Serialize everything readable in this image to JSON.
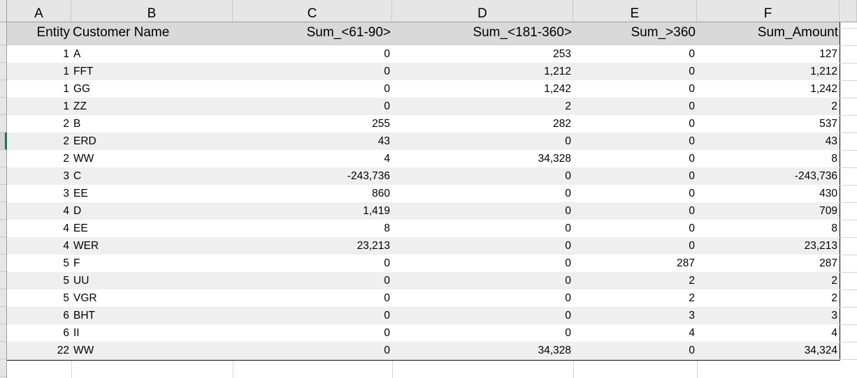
{
  "columns": [
    "A",
    "B",
    "C",
    "D",
    "E",
    "F"
  ],
  "headers": [
    "Entity",
    "Customer Name",
    "Sum_<61-90>",
    "Sum_<181-360>",
    "Sum_>360",
    "Sum_Amount"
  ],
  "selected_row_index": 5,
  "accent_color": "#217346",
  "rows": [
    [
      "1",
      "A",
      "0",
      "253",
      "0",
      "127"
    ],
    [
      "1",
      "FFT",
      "0",
      "1,212",
      "0",
      "1,212"
    ],
    [
      "1",
      "GG",
      "0",
      "1,242",
      "0",
      "1,242"
    ],
    [
      "1",
      "ZZ",
      "0",
      "2",
      "0",
      "2"
    ],
    [
      "2",
      "B",
      "255",
      "282",
      "0",
      "537"
    ],
    [
      "2",
      "ERD",
      "43",
      "0",
      "0",
      "43"
    ],
    [
      "2",
      "WW",
      "4",
      "34,328",
      "0",
      "8"
    ],
    [
      "3",
      "C",
      "-243,736",
      "0",
      "0",
      "-243,736"
    ],
    [
      "3",
      "EE",
      "860",
      "0",
      "0",
      "430"
    ],
    [
      "4",
      "D",
      "1,419",
      "0",
      "0",
      "709"
    ],
    [
      "4",
      "EE",
      "8",
      "0",
      "0",
      "8"
    ],
    [
      "4",
      "WER",
      "23,213",
      "0",
      "0",
      "23,213"
    ],
    [
      "5",
      "F",
      "0",
      "0",
      "287",
      "287"
    ],
    [
      "5",
      "UU",
      "0",
      "0",
      "2",
      "2"
    ],
    [
      "5",
      "VGR",
      "0",
      "0",
      "2",
      "2"
    ],
    [
      "6",
      "BHT",
      "0",
      "0",
      "3",
      "3"
    ],
    [
      "6",
      "II",
      "0",
      "0",
      "4",
      "4"
    ],
    [
      "22",
      "WW",
      "0",
      "34,328",
      "0",
      "34,324"
    ]
  ]
}
